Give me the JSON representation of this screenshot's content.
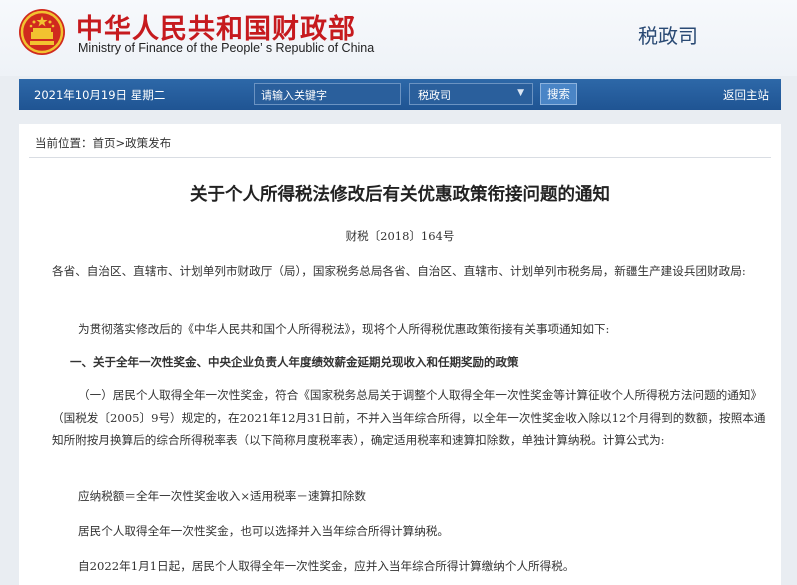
{
  "header": {
    "ministry_cn": "中华人民共和国财政部",
    "ministry_en": "Ministry of Finance of the People’ s Republic of China",
    "department": "税政司"
  },
  "navbar": {
    "date": "2021年10月19日  星期二",
    "search_placeholder": "请输入关键字",
    "select_value": "税政司",
    "search_button": "搜索",
    "home_link": "返回主站"
  },
  "breadcrumb": {
    "prefix": "当前位置：",
    "home": "首页",
    "sep": ">",
    "current": "政策发布"
  },
  "article": {
    "title": "关于个人所得税法修改后有关优惠政策衔接问题的通知",
    "doc_number": "财税〔2018〕164号",
    "addressee": "各省、自治区、直辖市、计划单列市财政厅（局），国家税务总局各省、自治区、直辖市、计划单列市税务局，新疆生产建设兵团财政局:",
    "intro": "为贯彻落实修改后的《中华人民共和国个人所得税法》，现将个人所得税优惠政策衔接有关事项通知如下:",
    "section1_heading": "一、关于全年一次性奖金、中央企业负责人年度绩效薪金延期兑现收入和任期奖励的政策",
    "section1_para": "（一）居民个人取得全年一次性奖金，符合《国家税务总局关于调整个人取得全年一次性奖金等计算征收个人所得税方法问题的通知》（国税发〔2005〕9号）规定的，在2021年12月31日前，不并入当年综合所得，以全年一次性奖金收入除以12个月得到的数额，按照本通知所附按月换算后的综合所得税率表（以下简称月度税率表），确定适用税率和速算扣除数，单独计算纳税。计算公式为:",
    "formula": "应纳税额＝全年一次性奖金收入×适用税率－速算扣除数",
    "option_note": "居民个人取得全年一次性奖金，也可以选择并入当年综合所得计算纳税。",
    "from_2022": "自2022年1月1日起，居民个人取得全年一次性奖金，应并入当年综合所得计算缴纳个人所得税。"
  },
  "colors": {
    "brand_red": "#c61a1e",
    "nav_blue": "#1f5493",
    "dept_blue": "#2a4a74"
  }
}
